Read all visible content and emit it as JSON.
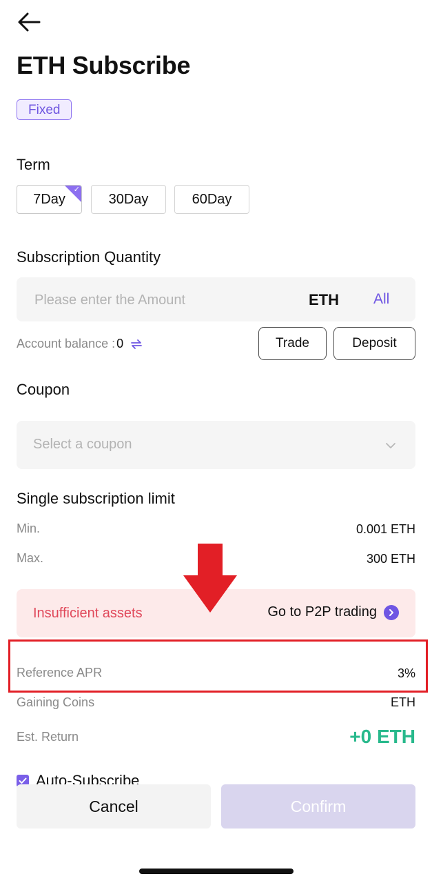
{
  "header": {
    "back_icon": "arrow-left-icon",
    "title": "ETH Subscribe",
    "badge": "Fixed"
  },
  "term": {
    "label": "Term",
    "options": [
      {
        "label": "7Day",
        "selected": true
      },
      {
        "label": "30Day",
        "selected": false
      },
      {
        "label": "60Day",
        "selected": false
      }
    ]
  },
  "subscription": {
    "label": "Subscription Quantity",
    "placeholder": "Please enter the Amount",
    "value": "",
    "unit": "ETH",
    "all_label": "All",
    "balance_label": "Account balance :",
    "balance_value": "0",
    "trade_label": "Trade",
    "deposit_label": "Deposit"
  },
  "coupon": {
    "label": "Coupon",
    "placeholder": "Select a coupon"
  },
  "limit": {
    "label": "Single subscription limit",
    "min_label": "Min.",
    "min_value": "0.001 ETH",
    "max_label": "Max.",
    "max_value": "300 ETH"
  },
  "alert": {
    "text": "Insufficient assets",
    "link": "Go to P2P trading"
  },
  "details": {
    "apr_label": "Reference APR",
    "apr_value": "3%",
    "coins_label": "Gaining Coins",
    "coins_value": "ETH",
    "return_label": "Est. Return",
    "return_value": "+0 ETH"
  },
  "auto_subscribe": {
    "label": "Auto-Subscribe",
    "checked": true
  },
  "actions": {
    "cancel": "Cancel",
    "confirm": "Confirm"
  },
  "colors": {
    "accent": "#6f56e3",
    "alert_text": "#e0485a",
    "alert_bg": "#fdeaea",
    "return_green": "#28b98c",
    "annotation_red": "#e21f26"
  }
}
